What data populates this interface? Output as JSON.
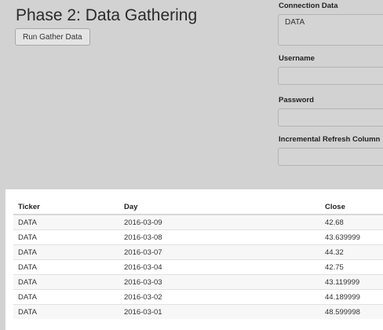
{
  "header": {
    "title": "Phase 2: Data Gathering",
    "run_button_label": "Run Gather Data"
  },
  "form": {
    "connection_data": {
      "label": "Connection Data",
      "value": "DATA"
    },
    "username": {
      "label": "Username",
      "value": ""
    },
    "password": {
      "label": "Password",
      "value": ""
    },
    "incremental_refresh_column": {
      "label": "Incremental Refresh Column",
      "value": ""
    }
  },
  "table": {
    "columns": [
      "Ticker",
      "Day",
      "Close"
    ],
    "rows": [
      [
        "DATA",
        "2016-03-09",
        "42.68"
      ],
      [
        "DATA",
        "2016-03-08",
        "43.639999"
      ],
      [
        "DATA",
        "2016-03-07",
        "44.32"
      ],
      [
        "DATA",
        "2016-03-04",
        "42.75"
      ],
      [
        "DATA",
        "2016-03-03",
        "43.119999"
      ],
      [
        "DATA",
        "2016-03-02",
        "44.189999"
      ],
      [
        "DATA",
        "2016-03-01",
        "48.599998"
      ]
    ]
  }
}
